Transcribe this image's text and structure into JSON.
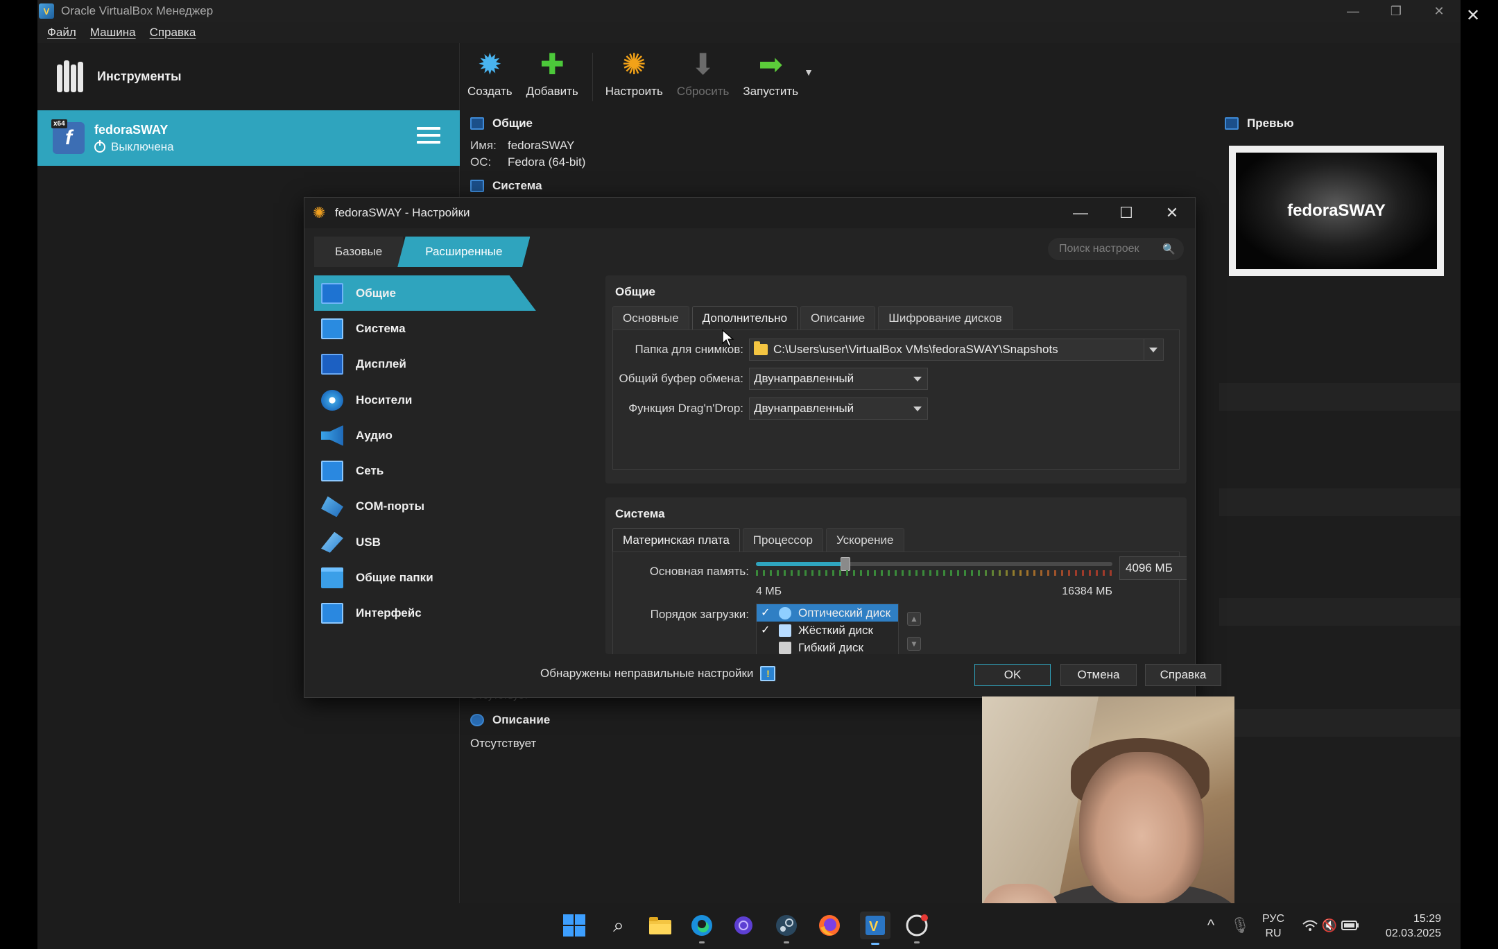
{
  "main_window": {
    "title": "Oracle VirtualBox Менеджер",
    "menu": [
      "Файл",
      "Машина",
      "Справка"
    ],
    "tools_label": "Инструменты",
    "vm": {
      "name": "fedoraSWAY",
      "state": "Выключена",
      "badge": "x64"
    },
    "toolbar": [
      {
        "label": "Создать",
        "icon": "create-icon",
        "enabled": true
      },
      {
        "label": "Добавить",
        "icon": "add-icon",
        "enabled": true
      },
      {
        "label": "Настроить",
        "icon": "settings-gear-icon",
        "enabled": true
      },
      {
        "label": "Сбросить",
        "icon": "discard-icon",
        "enabled": false
      },
      {
        "label": "Запустить",
        "icon": "start-arrow-icon",
        "enabled": true
      }
    ],
    "details": {
      "general_head": "Общие",
      "name_label": "Имя:",
      "name_value": "fedoraSWAY",
      "os_label": "ОС:",
      "os_value": "Fedora (64-bit)",
      "system_head": "Система",
      "description_head": "Описание",
      "description_value": "Отсутствует",
      "hidden_partial": "Отсутствует"
    },
    "preview": {
      "head": "Превью",
      "screen_text": "fedoraSWAY"
    }
  },
  "dialog": {
    "title": "fedoraSWAY - Настройки",
    "mode_tabs": [
      "Базовые",
      "Расширенные"
    ],
    "active_mode": "Расширенные",
    "search_placeholder": "Поиск настроек",
    "categories": [
      "Общие",
      "Система",
      "Дисплей",
      "Носители",
      "Аудио",
      "Сеть",
      "COM-порты",
      "USB",
      "Общие папки",
      "Интерфейс"
    ],
    "active_category": "Общие",
    "general": {
      "title": "Общие",
      "tabs": [
        "Основные",
        "Дополнительно",
        "Описание",
        "Шифрование дисков"
      ],
      "active_tab": "Дополнительно",
      "snapshot_folder_label": "Папка для снимков:",
      "snapshot_folder_value": "C:\\Users\\user\\VirtualBox VMs\\fedoraSWAY\\Snapshots",
      "clipboard_label": "Общий буфер обмена:",
      "clipboard_value": "Двунаправленный",
      "dnd_label": "Функция Drag'n'Drop:",
      "dnd_value": "Двунаправленный"
    },
    "system": {
      "title": "Система",
      "tabs": [
        "Материнская плата",
        "Процессор",
        "Ускорение"
      ],
      "active_tab": "Материнская плата",
      "memory_label": "Основная память:",
      "memory_value": "4096 МБ",
      "memory_min": "4 МБ",
      "memory_max": "16384 МБ",
      "memory_fraction": 0.25,
      "boot_label": "Порядок загрузки:",
      "boot_items": [
        {
          "label": "Оптический диск",
          "checked": "✓",
          "selected": true
        },
        {
          "label": "Жёсткий диск",
          "checked": "✓",
          "selected": false
        },
        {
          "label": "Гибкий диск",
          "checked": "",
          "selected": false
        }
      ]
    },
    "warning": "Обнаружены неправильные настройки",
    "buttons": {
      "ok": "OK",
      "cancel": "Отмена",
      "help": "Справка"
    }
  },
  "taskbar": {
    "lang_top": "РУС",
    "lang_bottom": "RU",
    "time": "15:29",
    "date": "02.03.2025"
  },
  "colors": {
    "accent": "#2fa4be",
    "dialog_bg": "#232323",
    "window_bg": "#1d1d1d"
  }
}
